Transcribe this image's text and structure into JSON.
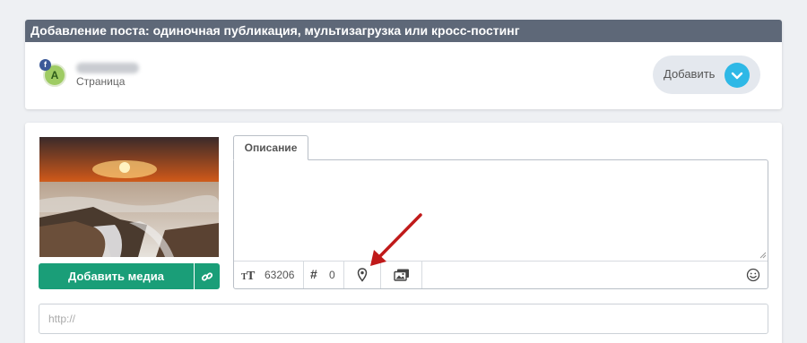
{
  "header": {
    "title": "Добавление поста: одиночная публикация, мультизагрузка или кросс-постинг"
  },
  "account": {
    "avatar_letter": "A",
    "network_badge": "f",
    "type_label": "Страница",
    "name_blurred": true
  },
  "add_button": {
    "label": "Добавить",
    "icon": "chevron-down-icon"
  },
  "media": {
    "add_media_label": "Добавить медиа",
    "link_icon": "link-icon",
    "thumbnail": "sunset-sea-rocks-photo"
  },
  "editor": {
    "tab_label": "Описание",
    "text_value": "",
    "toolbar": {
      "chars_icon": "text-size-icon",
      "chars_remaining": "63206",
      "hashtag_icon": "hashtag-icon",
      "hashtag_count": "0",
      "location_icon": "location-pin-icon",
      "gallery_icon": "gallery-icon",
      "emoji_icon": "smiley-icon"
    }
  },
  "url_field": {
    "placeholder": "http://"
  },
  "colors": {
    "header_bg": "#5e6878",
    "accent_green": "#1a9e78",
    "accent_blue": "#2eb8e6",
    "arrow_red": "#c01a1a"
  }
}
